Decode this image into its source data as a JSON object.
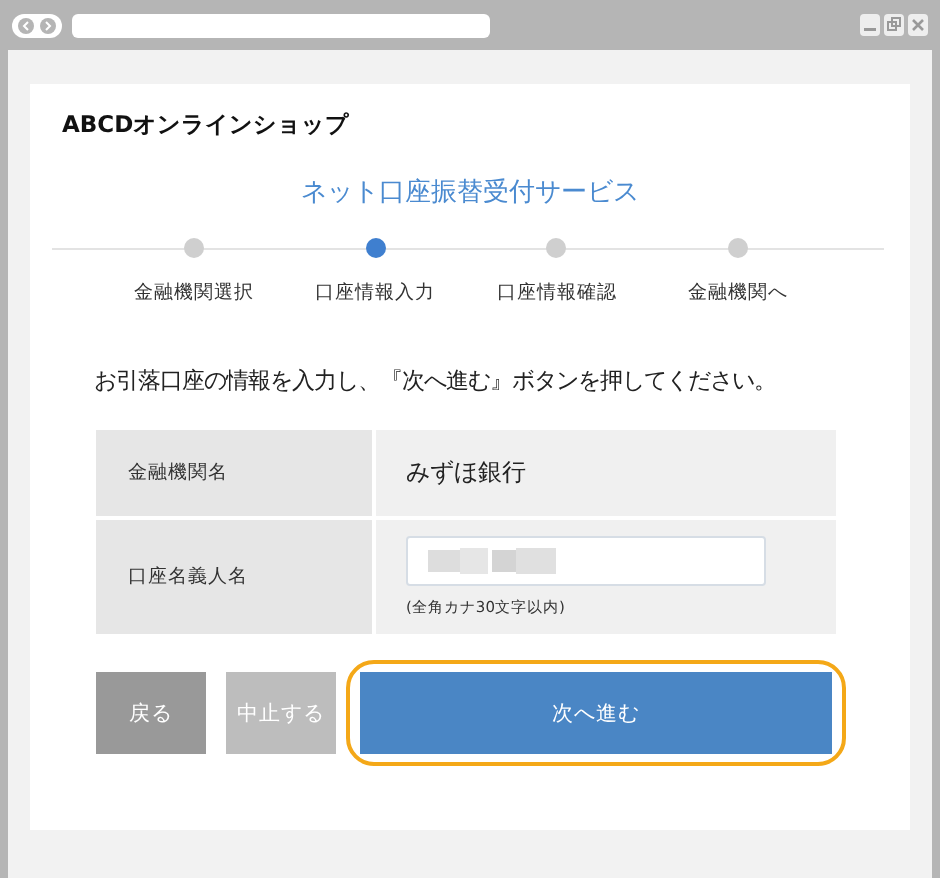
{
  "shop_name": "ABCDオンラインショップ",
  "service_title": "ネット口座振替受付サービス",
  "steps": [
    {
      "label": "金融機関選択",
      "selected": false
    },
    {
      "label": "口座情報入力",
      "selected": true
    },
    {
      "label": "口座情報確認",
      "selected": false
    },
    {
      "label": "金融機関へ",
      "selected": false
    }
  ],
  "instruction": "お引落口座の情報を入力し、『次へ進む』ボタンを押してください。",
  "form": {
    "rows": [
      {
        "kind": "text",
        "label": "金融機関名",
        "value": "みずほ銀行"
      },
      {
        "kind": "input",
        "label": "口座名義人名",
        "note": "(全角カナ30文字以内)"
      }
    ]
  },
  "buttons": [
    {
      "kind": "back",
      "label": "戻る",
      "focused": false
    },
    {
      "kind": "cancel",
      "label": "中止する",
      "focused": false
    },
    {
      "kind": "next",
      "label": "次へ進む",
      "focused": true
    }
  ]
}
